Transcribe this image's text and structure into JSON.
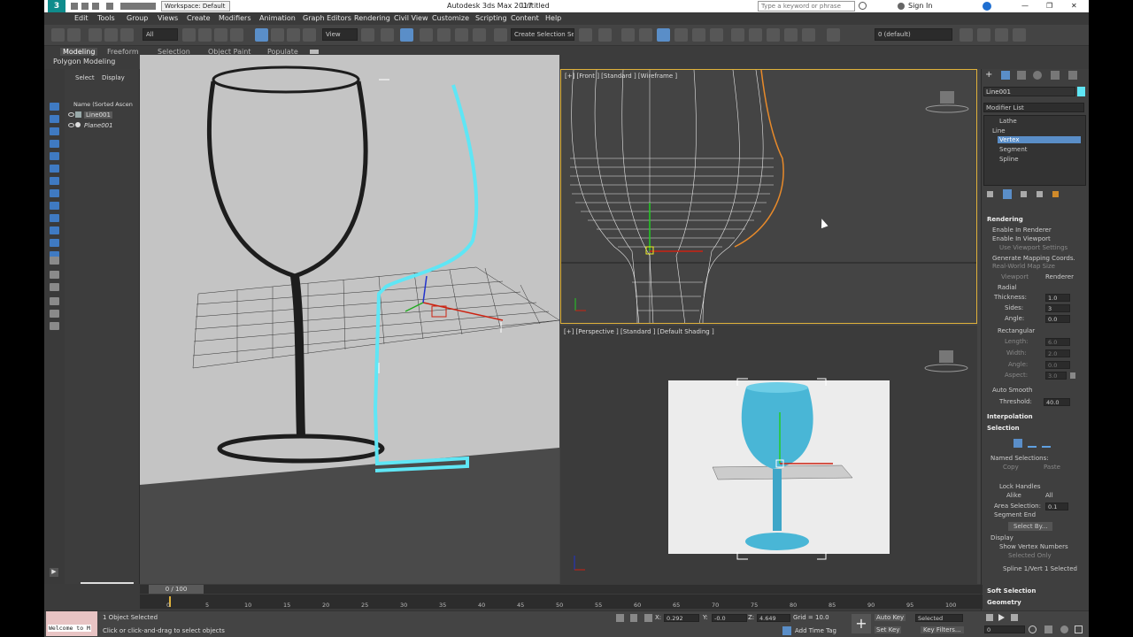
{
  "app": {
    "title": "Autodesk 3ds Max 2017",
    "document": "Untitled",
    "workspace": "Workspace: Default",
    "search_placeholder": "Type a keyword or phrase",
    "sign_in": "Sign In"
  },
  "menu": [
    "Edit",
    "Tools",
    "Group",
    "Views",
    "Create",
    "Modifiers",
    "Animation",
    "Graph Editors",
    "Rendering",
    "Civil View",
    "Customize",
    "Scripting",
    "Content",
    "Help"
  ],
  "toolbar": {
    "filter": "All",
    "view": "View",
    "selection_set": "Create Selection Se",
    "layer": "0 (default)"
  },
  "ribbon": {
    "tabs": [
      "Modeling",
      "Freeform",
      "Selection",
      "Object Paint",
      "Populate"
    ],
    "sub": "Polygon Modeling"
  },
  "scene": {
    "tabs": [
      "Select",
      "Display"
    ],
    "header": "Name (Sorted Ascen",
    "items": [
      "Line001",
      "Plane001"
    ]
  },
  "viewports": {
    "front_label": "[+] [Front ] [Standard ] [Wireframe ]",
    "persp_label": "[+] [Perspective ] [Standard ] [Default Shading ]"
  },
  "command_panel": {
    "object_name": "Line001",
    "modifier_list": "Modifier List",
    "stack": [
      "Lathe",
      "Line",
      "Vertex",
      "Segment",
      "Spline"
    ],
    "rendering": {
      "title": "Rendering",
      "enable_renderer": "Enable In Renderer",
      "enable_viewport": "Enable In Viewport",
      "use_viewport": "Use Viewport Settings",
      "gen_mapping": "Generate Mapping Coords.",
      "real_world": "Real-World Map Size",
      "viewport": "Viewport",
      "renderer": "Renderer",
      "radial": "Radial",
      "thickness_label": "Thickness:",
      "thickness": "1.0",
      "sides_label": "Sides:",
      "sides": "3",
      "angle_label": "Angle:",
      "angle": "0.0",
      "rectangular": "Rectangular",
      "length_label": "Length:",
      "length": "6.0",
      "width_label": "Width:",
      "width": "2.0",
      "angle2_label": "Angle:",
      "angle2": "0.0",
      "aspect_label": "Aspect:",
      "aspect": "3.0",
      "auto_smooth": "Auto Smooth",
      "threshold_label": "Threshold:",
      "threshold": "40.0"
    },
    "interpolation": "Interpolation",
    "selection": {
      "title": "Selection",
      "named_selections": "Named Selections:",
      "copy": "Copy",
      "paste": "Paste",
      "lock_handles": "Lock Handles",
      "alike": "Alike",
      "all": "All",
      "area_selection": "Area Selection:",
      "area_value": "0.1",
      "segment_end": "Segment End",
      "select_by": "Select By...",
      "display": "Display",
      "show_vertex_numbers": "Show Vertex Numbers",
      "selected_only": "Selected Only",
      "status": "Spline 1/Vert 1 Selected"
    },
    "soft_selection": "Soft Selection",
    "geometry": "Geometry"
  },
  "timeline": {
    "frame": "0 / 100",
    "ticks": [
      "0",
      "5",
      "10",
      "15",
      "20",
      "25",
      "30",
      "35",
      "40",
      "45",
      "50",
      "55",
      "60",
      "65",
      "70",
      "75",
      "80",
      "85",
      "90",
      "95",
      "100"
    ]
  },
  "status": {
    "maxscript": "Welcome to M",
    "objects": "1 Object Selected",
    "prompt": "Click or click-and-drag to select objects",
    "x_label": "X:",
    "x": "0.292",
    "y_label": "Y:",
    "y": "-0.0",
    "z_label": "Z:",
    "z": "4.649",
    "grid": "Grid = 10.0",
    "add_time_tag": "Add Time Tag",
    "auto_key": "Auto Key",
    "selected": "Selected",
    "set_key": "Set Key",
    "key_filters": "Key Filters...",
    "frame_field": "0"
  },
  "colors": {
    "accent": "#3f7ac2",
    "selection_cyan": "#5fe6f5",
    "viewport_border": "#e0b23a",
    "glass_cyan": "#49b6d6"
  }
}
